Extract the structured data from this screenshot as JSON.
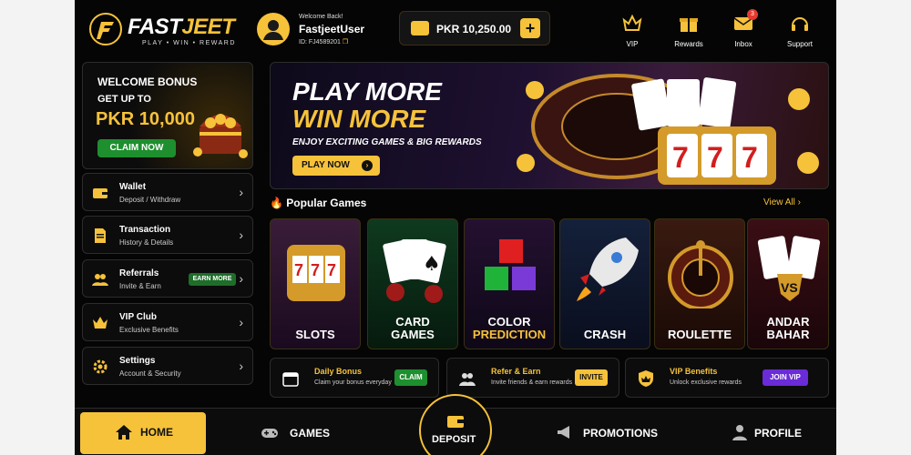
{
  "brand": {
    "name_a": "FAST",
    "name_b": "JEET",
    "tagline": "PLAY • WIN • REWARD"
  },
  "user": {
    "welcome": "Welcome Back!",
    "username": "FastjeetUser",
    "id": "ID: FJ4589201"
  },
  "balance": {
    "amount": "PKR 10,250.00",
    "add_label": "+"
  },
  "top_nav": [
    {
      "label": "VIP",
      "icon": "crown-diamond-icon"
    },
    {
      "label": "Rewards",
      "icon": "gift-icon"
    },
    {
      "label": "Inbox",
      "icon": "mail-icon",
      "badge": "3"
    },
    {
      "label": "Support",
      "icon": "headset-icon"
    }
  ],
  "welcome": {
    "title": "WELCOME BONUS",
    "up_to": "GET UP TO",
    "amount": "PKR 10,000",
    "button": "CLAIM NOW"
  },
  "sidebar": [
    {
      "title": "Wallet",
      "sub": "Deposit / Withdraw",
      "icon": "wallet-icon"
    },
    {
      "title": "Transaction",
      "sub": "History & Details",
      "icon": "document-icon"
    },
    {
      "title": "Referrals",
      "sub": "Invite & Earn",
      "icon": "users-icon",
      "badge": "EARN MORE"
    },
    {
      "title": "VIP Club",
      "sub": "Exclusive Benefits",
      "icon": "crown-icon"
    },
    {
      "title": "Settings",
      "sub": "Account & Security",
      "icon": "gear-icon"
    }
  ],
  "banner": {
    "line1": "PLAY MORE",
    "line2": "WIN MORE",
    "sub": "ENJOY EXCITING GAMES & BIG REWARDS",
    "button": "PLAY NOW"
  },
  "popular": {
    "title": "Popular Games",
    "view_all": "View All ›"
  },
  "games": [
    {
      "label": "SLOTS",
      "icon": "slot-machine-icon",
      "label_color": "#ffffff"
    },
    {
      "label_a": "CARD",
      "label_b": "GAMES",
      "icon": "cards-icon",
      "label_color": "#ffffff"
    },
    {
      "label_a": "COLOR",
      "label_b": "PREDICTION",
      "icon": "cubes-icon",
      "label_color": "#ffffff",
      "label_b_color": "#f6c23a"
    },
    {
      "label": "CRASH",
      "icon": "rocket-icon",
      "label_color": "#ffffff"
    },
    {
      "label": "ROULETTE",
      "icon": "roulette-icon",
      "label_color": "#ffffff"
    },
    {
      "label_a": "ANDAR",
      "label_b": "BAHAR",
      "icon": "versus-icon",
      "label_color": "#ffffff"
    }
  ],
  "promos": [
    {
      "title": "Daily Bonus",
      "sub": "Claim your bonus everyday",
      "button": "CLAIM",
      "icon": "calendar-icon",
      "color": "#1e8f2e"
    },
    {
      "title": "Refer & Earn",
      "sub": "Invite friends & earn rewards",
      "button": "INVITE",
      "icon": "users-icon",
      "color": "#f6c23a"
    },
    {
      "title": "VIP Benefits",
      "sub": "Unlock exclusive rewards",
      "button": "JOIN VIP",
      "icon": "vip-shield-icon",
      "color": "#6a2bd8"
    }
  ],
  "bottom_nav": {
    "home": "HOME",
    "games": "GAMES",
    "deposit": "DEPOSIT",
    "promotions": "PROMOTIONS",
    "profile": "PROFILE"
  }
}
